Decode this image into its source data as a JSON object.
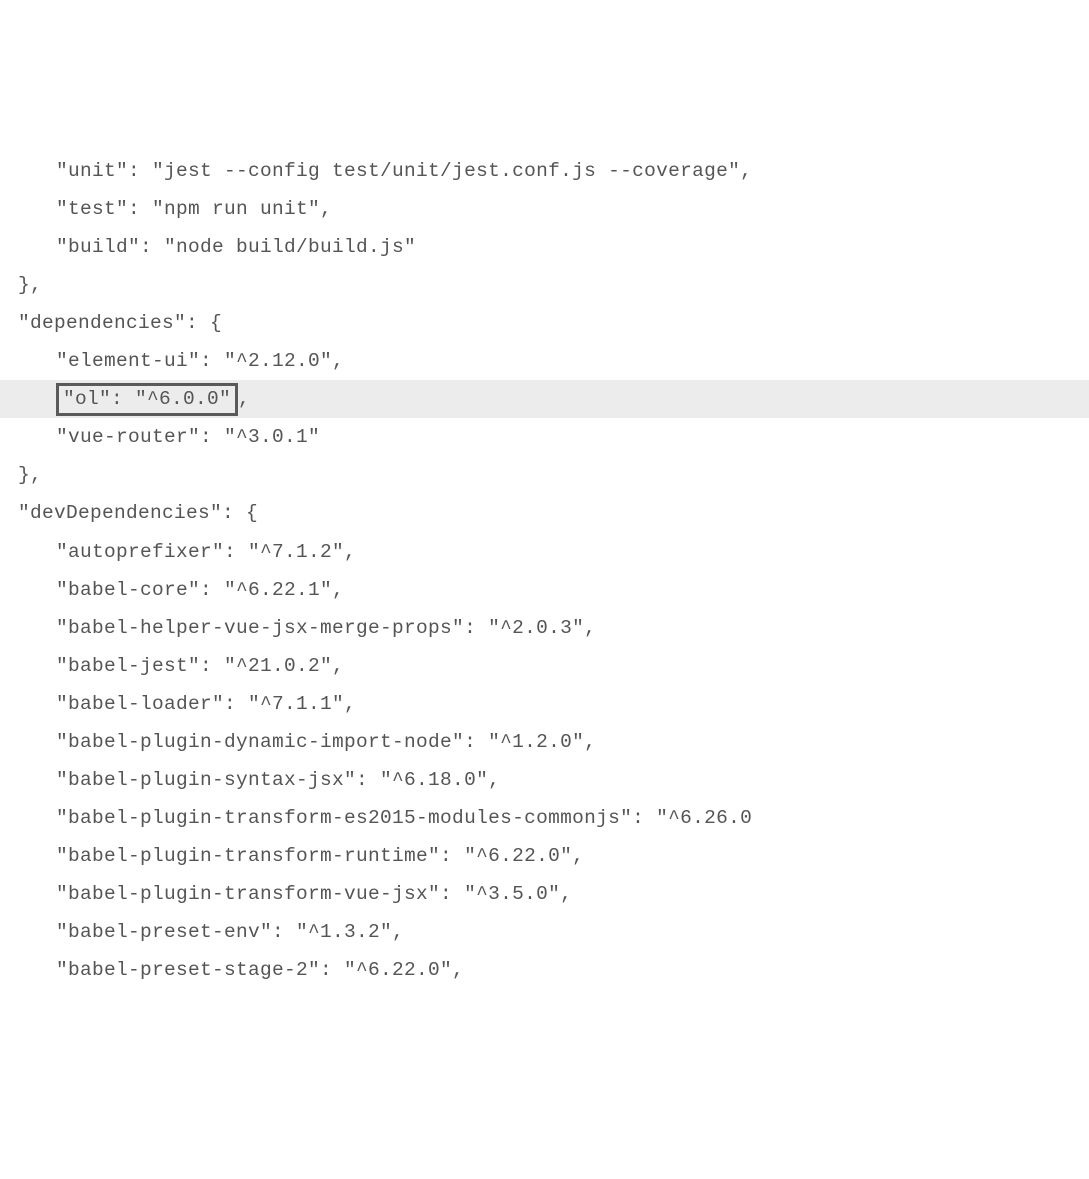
{
  "lines": [
    {
      "indent": 2,
      "text": "\"unit\": \"jest --config test/unit/jest.conf.js --coverage\","
    },
    {
      "indent": 2,
      "text": "\"test\": \"npm run unit\","
    },
    {
      "indent": 2,
      "text": "\"build\": \"node build/build.js\""
    },
    {
      "indent": 1,
      "text": "},"
    },
    {
      "indent": 1,
      "text": "\"dependencies\": {"
    },
    {
      "indent": 2,
      "text": "\"element-ui\": \"^2.12.0\","
    },
    {
      "indent": 2,
      "boxed": true,
      "highlighted": true,
      "boxText": "\"ol\": \"^6.0.0\"",
      "afterBox": ","
    },
    {
      "indent": 2,
      "text": "\"vue-router\": \"^3.0.1\""
    },
    {
      "indent": 1,
      "text": "},"
    },
    {
      "indent": 1,
      "text": "\"devDependencies\": {"
    },
    {
      "indent": 2,
      "text": "\"autoprefixer\": \"^7.1.2\","
    },
    {
      "indent": 2,
      "text": "\"babel-core\": \"^6.22.1\","
    },
    {
      "indent": 2,
      "text": "\"babel-helper-vue-jsx-merge-props\": \"^2.0.3\","
    },
    {
      "indent": 2,
      "text": "\"babel-jest\": \"^21.0.2\","
    },
    {
      "indent": 2,
      "text": "\"babel-loader\": \"^7.1.1\","
    },
    {
      "indent": 2,
      "text": "\"babel-plugin-dynamic-import-node\": \"^1.2.0\","
    },
    {
      "indent": 2,
      "text": "\"babel-plugin-syntax-jsx\": \"^6.18.0\","
    },
    {
      "indent": 2,
      "text": "\"babel-plugin-transform-es2015-modules-commonjs\": \"^6.26.0"
    },
    {
      "indent": 2,
      "text": "\"babel-plugin-transform-runtime\": \"^6.22.0\","
    },
    {
      "indent": 2,
      "text": "\"babel-plugin-transform-vue-jsx\": \"^3.5.0\","
    },
    {
      "indent": 2,
      "text": "\"babel-preset-env\": \"^1.3.2\","
    },
    {
      "indent": 2,
      "text": "\"babel-preset-stage-2\": \"^6.22.0\","
    }
  ]
}
